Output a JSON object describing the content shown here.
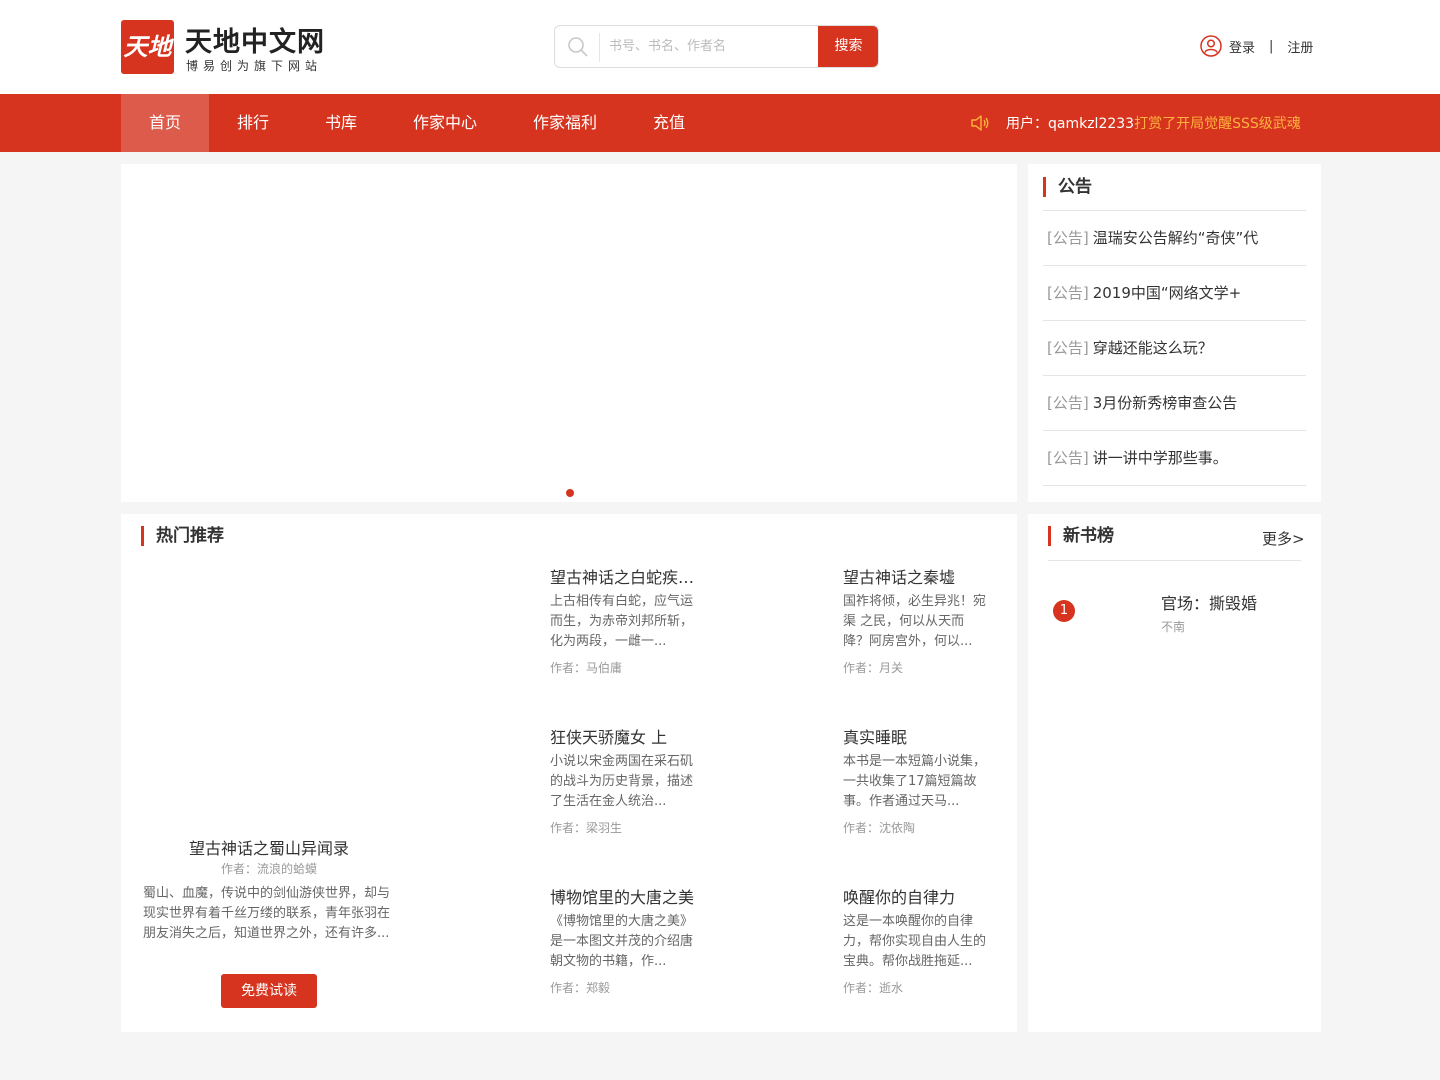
{
  "header": {
    "logo_mark": "天地",
    "site_name": "天地中文网",
    "tagline": "博易创为旗下网站",
    "search_placeholder": "书号、书名、作者名",
    "search_button": "搜索",
    "login": "登录",
    "divider": "|",
    "register": "注册"
  },
  "nav": {
    "items": [
      "首页",
      "排行",
      "书库",
      "作家中心",
      "作家福利",
      "充值"
    ],
    "active_index": 0,
    "notice_user": "用户：qamkzl2233",
    "notice_action": "打赏了开局觉醒SSS级武魂"
  },
  "announcements": {
    "title": "公告",
    "items": [
      {
        "tag": "[公告]",
        "text": "温瑞安公告解约“奇侠”代"
      },
      {
        "tag": "[公告]",
        "text": "2019中国“网络文学+"
      },
      {
        "tag": "[公告]",
        "text": "穿越还能这么玩？"
      },
      {
        "tag": "[公告]",
        "text": "3月份新秀榜审查公告"
      },
      {
        "tag": "[公告]",
        "text": "讲一讲中学那些事。"
      }
    ]
  },
  "hot": {
    "title": "热门推荐",
    "featured": {
      "title": "望古神话之蜀山异闻录",
      "author": "作者：流浪的蛤蟆",
      "desc": "蜀山、血魔，传说中的剑仙游侠世界，却与现实世界有着千丝万缕的联系，青年张羽在朋友消失之后，知道世界之外，还有许多...",
      "button": "免费试读"
    },
    "books": [
      {
        "title": "望古神话之白蛇疾…",
        "desc": "上古相传有白蛇，应气运而生，为赤帝刘邦所斩，化为两段，一雌一...",
        "author": "作者：马伯庸"
      },
      {
        "title": "望古神话之秦墟",
        "desc": "国祚将倾，必生异兆！宛渠 之民，何以从天而降？阿房宫外，何以...",
        "author": "作者：月关"
      },
      {
        "title": "狂侠天骄魔女 上",
        "desc": "小说以宋金两国在采石矶的战斗为历史背景，描述了生活在金人统治...",
        "author": "作者：梁羽生"
      },
      {
        "title": "真实睡眠",
        "desc": "本书是一本短篇小说集，一共收集了17篇短篇故事。作者通过天马...",
        "author": "作者：沈依陶"
      },
      {
        "title": "博物馆里的大唐之美",
        "desc": "《博物馆里的大唐之美》是一本图文并茂的介绍唐朝文物的书籍，作...",
        "author": "作者：郑毅"
      },
      {
        "title": "唤醒你的自律力",
        "desc": "这是一本唤醒你的自律力，帮你实现自由人生的宝典。帮你战胜拖延...",
        "author": "作者：逝水"
      }
    ]
  },
  "newbooks": {
    "title": "新书榜",
    "more": "更多>",
    "items": [
      {
        "rank": "1",
        "title": "官场：撕毁婚",
        "author": "不南"
      }
    ]
  },
  "colors": {
    "brand": "#d6341f",
    "nav_active": "#dc5b4a",
    "notice_highlight": "#ffb23e"
  }
}
